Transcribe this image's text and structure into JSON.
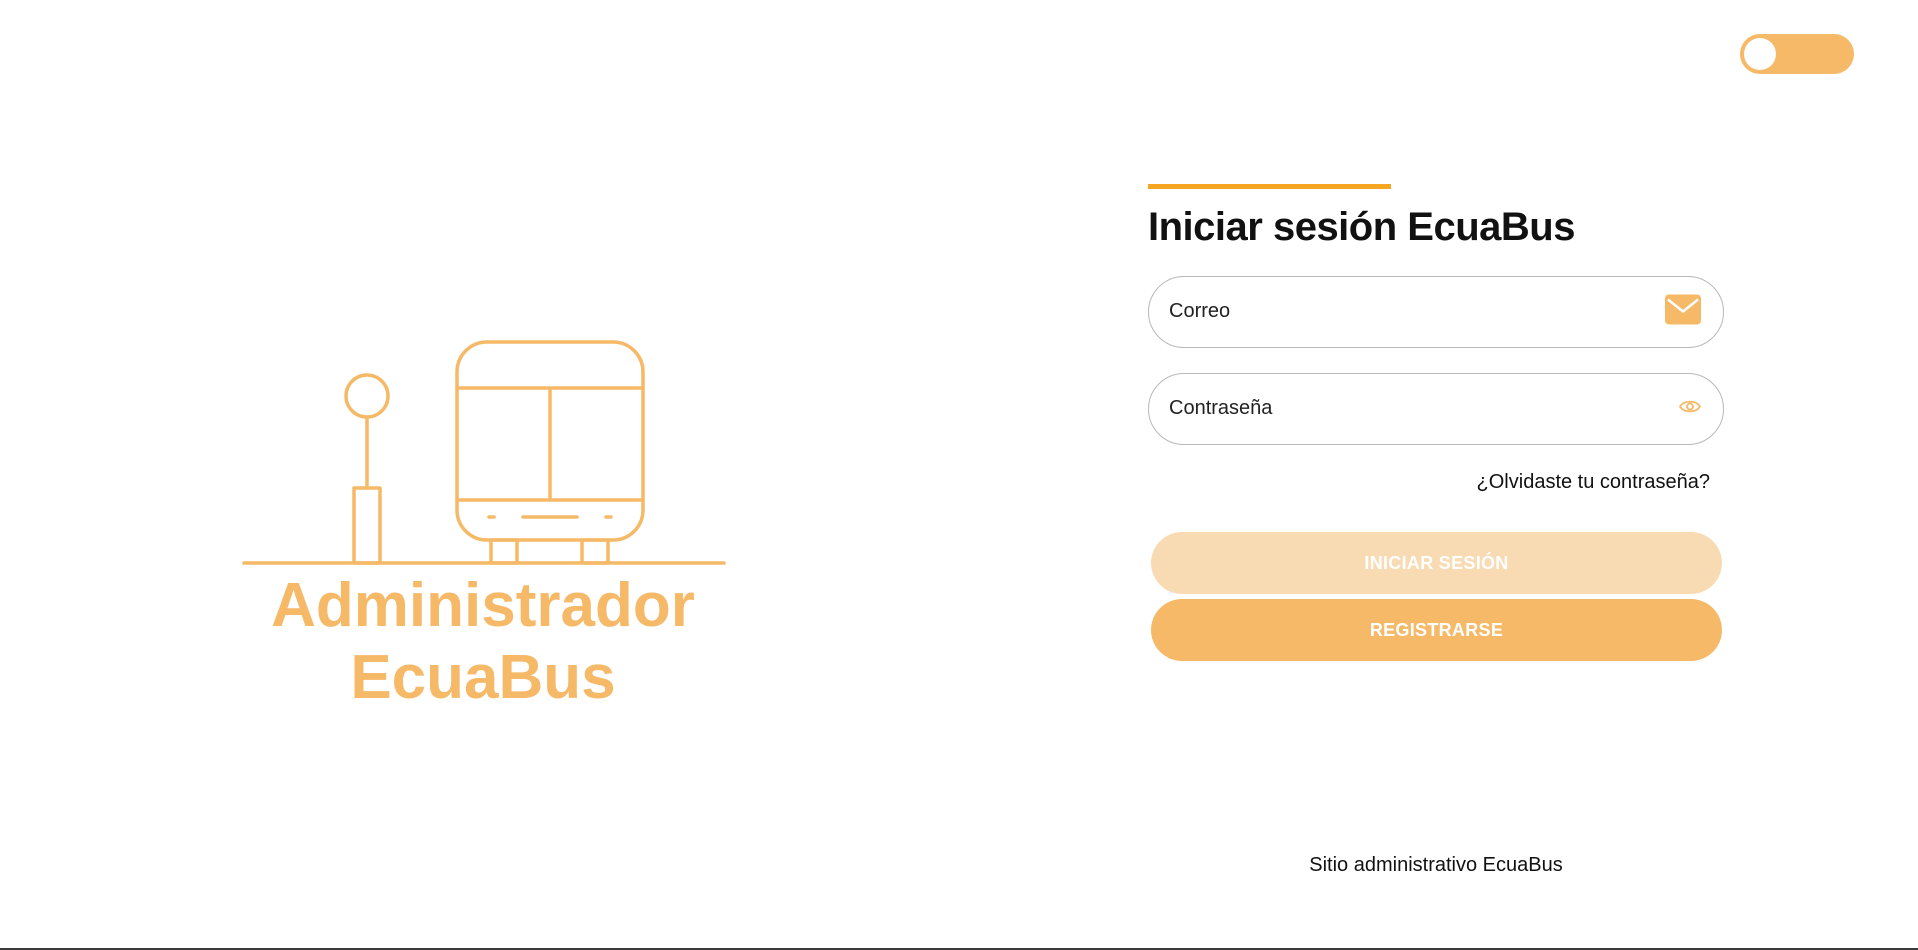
{
  "brand": {
    "line1": "Administrador",
    "line2": "EcuaBus",
    "accent_color": "#f5b967"
  },
  "login": {
    "heading": "Iniciar sesión EcuaBus",
    "email_placeholder": "Correo",
    "email_icon": "envelope-icon",
    "password_placeholder": "Contraseña",
    "password_icon": "eye-icon",
    "forgot_link": "¿Olvidaste tu contraseña?",
    "login_button": "INICIAR SESIÓN",
    "register_button": "REGISTRARSE"
  },
  "footer": {
    "text": "Sitio administrativo EcuaBus"
  },
  "theme_toggle": {
    "state": "off"
  }
}
